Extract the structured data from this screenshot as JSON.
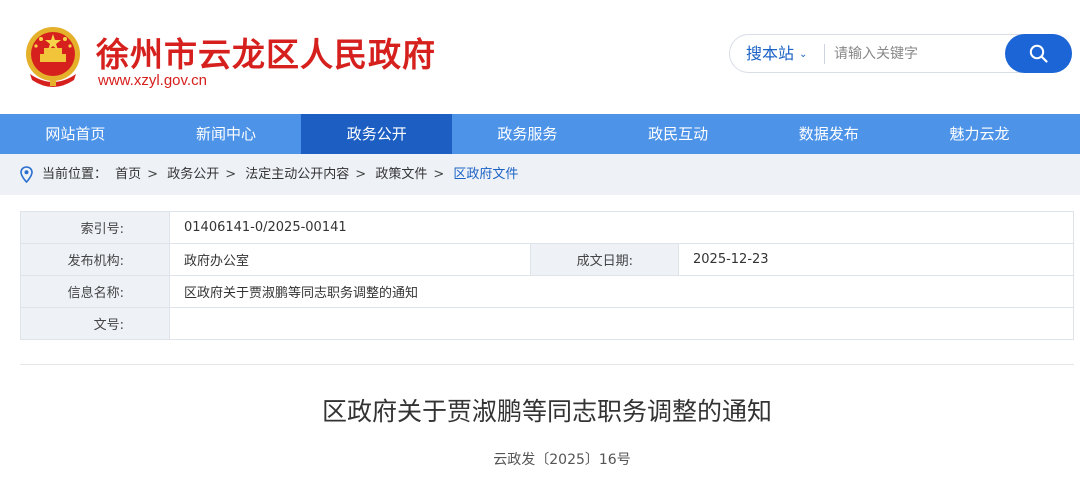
{
  "header": {
    "site_title": "徐州市云龙区人民政府",
    "site_url": "www.xzyl.gov.cn",
    "emblem_icon": "national-emblem-icon",
    "brand_color": "#d6201d"
  },
  "search": {
    "scope_label": "搜本站",
    "placeholder": "请输入关键字",
    "button_icon": "search-icon"
  },
  "nav": {
    "items": [
      {
        "label": "网站首页"
      },
      {
        "label": "新闻中心"
      },
      {
        "label": "政务公开"
      },
      {
        "label": "政务服务"
      },
      {
        "label": "政民互动"
      },
      {
        "label": "数据发布"
      },
      {
        "label": "魅力云龙"
      }
    ],
    "active": "政务公开",
    "color": "#4d93e8",
    "active_color": "#1c5ec2"
  },
  "breadcrumb": {
    "prefix": "当前位置：",
    "items": [
      "首页",
      "政务公开",
      "法定主动公开内容",
      "政策文件",
      "区政府文件"
    ],
    "separator": ">"
  },
  "info": {
    "index_label": "索引号:",
    "index_value": "01406141-0/2025-00141",
    "publisher_label": "发布机构:",
    "publisher_value": "政府办公室",
    "date_label": "成文日期:",
    "date_value": "2025-12-23",
    "name_label": "信息名称:",
    "name_value": "区政府关于贾淑鹏等同志职务调整的通知",
    "docno_label": "文号:",
    "docno_value": ""
  },
  "document": {
    "title": "区政府关于贾淑鹏等同志职务调整的通知",
    "number": "云政发〔2025〕16号"
  }
}
